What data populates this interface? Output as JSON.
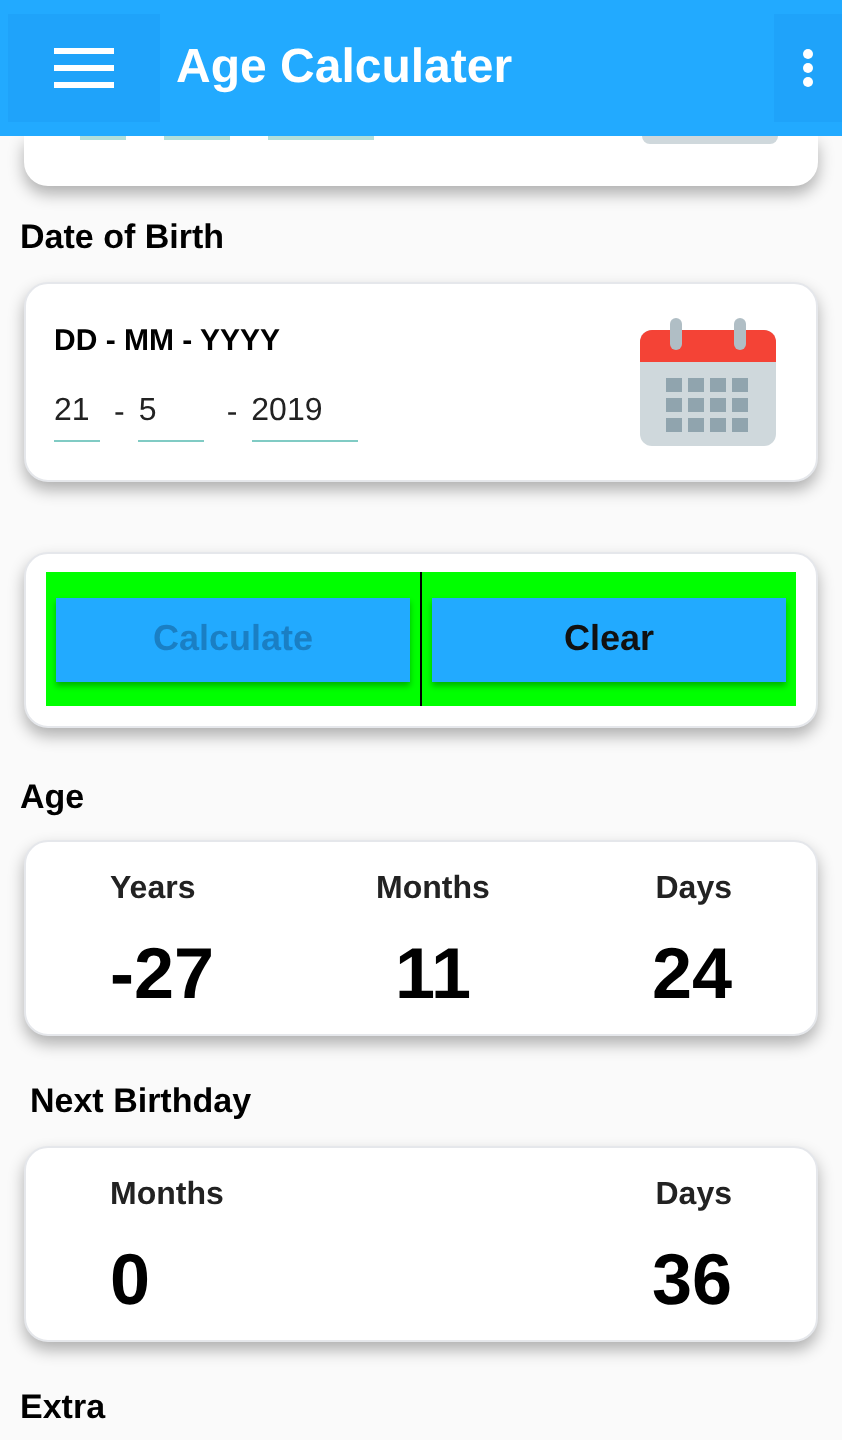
{
  "app_bar": {
    "title": "Age Calculater"
  },
  "date_of_birth": {
    "label": "Date of Birth",
    "format": "DD - MM - YYYY",
    "fields": [
      {
        "value": "21"
      },
      {
        "value": "5"
      },
      {
        "value": "2019"
      }
    ],
    "separators": [
      "-",
      "-"
    ]
  },
  "buttons": [
    {
      "label": "Calculate",
      "disabled": true
    },
    {
      "label": "Clear",
      "disabled": false
    }
  ],
  "age": {
    "label": "Age",
    "items": [
      {
        "label": "Years",
        "value": "-27"
      },
      {
        "label": "Months",
        "value": "11"
      },
      {
        "label": "Days",
        "value": "24"
      }
    ]
  },
  "next_birthday": {
    "label": "Next Birthday",
    "items": [
      {
        "label": "Months",
        "value": "0"
      },
      {
        "label": "Days",
        "value": "36"
      }
    ]
  },
  "extra": {
    "label": "Extra"
  }
}
